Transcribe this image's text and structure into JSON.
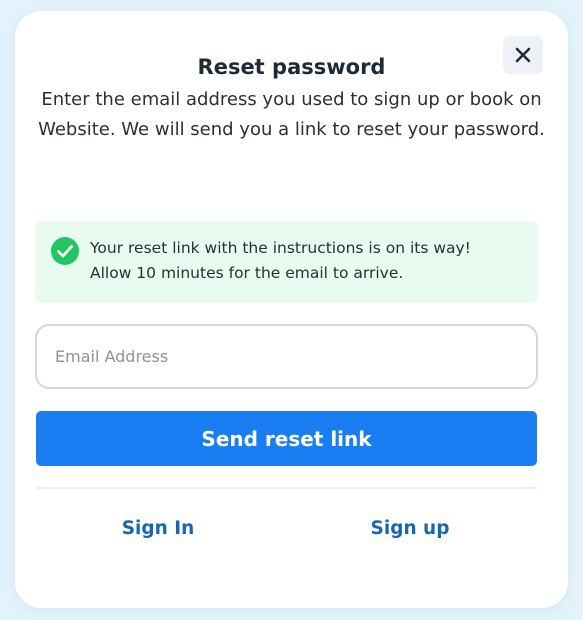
{
  "modal": {
    "title": "Reset password",
    "description": "Enter the email address you used to sign up or book on Website. We will send you a link to reset your password.",
    "close_icon": "close-icon"
  },
  "alert": {
    "icon": "check-circle-icon",
    "line1": "Your reset link with the instructions is on its way!",
    "line2": "Allow 10 minutes for the email to arrive."
  },
  "form": {
    "email_placeholder": "Email Address",
    "email_value": "",
    "submit_label": "Send reset link"
  },
  "footer": {
    "signin_label": "Sign In",
    "signup_label": "Sign up"
  },
  "colors": {
    "primary": "#1a7ef3",
    "success": "#22c55e",
    "success_bg": "#e8fbf0",
    "link": "#1666b8"
  }
}
